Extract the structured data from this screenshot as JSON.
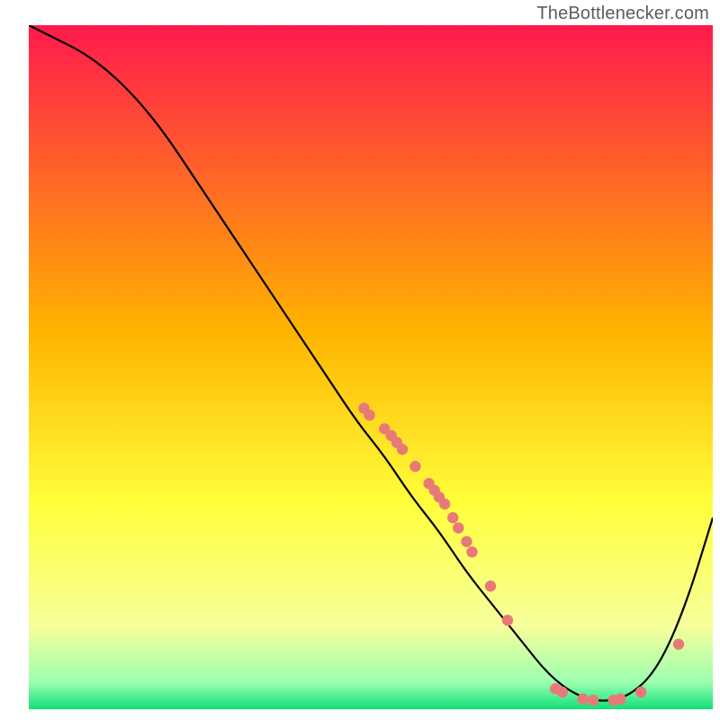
{
  "attribution": "TheBottlenecker.com",
  "colors": {
    "gradient": [
      {
        "offset": "0%",
        "color": "#ff1a4d"
      },
      {
        "offset": "45%",
        "color": "#ffb400"
      },
      {
        "offset": "70%",
        "color": "#ffff3c"
      },
      {
        "offset": "88%",
        "color": "#f6ff9c"
      },
      {
        "offset": "96%",
        "color": "#9cffb0"
      },
      {
        "offset": "100%",
        "color": "#12e07a"
      }
    ],
    "curve_stroke": "#000000",
    "dot_fill": "#e77a78",
    "dot_stroke": "#b65553"
  },
  "chart_data": {
    "type": "line",
    "title": "",
    "xlabel": "",
    "ylabel": "",
    "xlim": [
      0,
      100
    ],
    "ylim": [
      0,
      100
    ],
    "note": "Axes unlabeled in source; values are approximate percentages of plot width/height (0–100). y is 'distance from bottom' so low y ≈ green optimum.",
    "series": [
      {
        "name": "curve",
        "x": [
          0,
          4,
          8,
          12,
          16,
          20,
          24,
          28,
          32,
          36,
          40,
          44,
          48,
          52,
          56,
          60,
          64,
          68,
          72,
          76,
          80,
          84,
          88,
          92,
          96,
          100
        ],
        "y": [
          100,
          98,
          96,
          93,
          89,
          84,
          78,
          72,
          66,
          60,
          54,
          48,
          42,
          37,
          31,
          26,
          20,
          15,
          10,
          5,
          2,
          1,
          2,
          6,
          15,
          28
        ]
      }
    ],
    "points": {
      "name": "highlighted-dots",
      "note": "Pink/coral dots sitting on the curve; coordinates approximate.",
      "xy": [
        [
          49.0,
          44.0
        ],
        [
          49.8,
          43.0
        ],
        [
          52.0,
          41.0
        ],
        [
          53.0,
          40.0
        ],
        [
          53.8,
          39.0
        ],
        [
          54.6,
          38.0
        ],
        [
          56.5,
          35.5
        ],
        [
          58.5,
          33.0
        ],
        [
          59.3,
          32.0
        ],
        [
          60.0,
          31.0
        ],
        [
          60.8,
          30.0
        ],
        [
          62.0,
          28.0
        ],
        [
          62.8,
          26.5
        ],
        [
          64.0,
          24.5
        ],
        [
          64.8,
          23.0
        ],
        [
          67.5,
          18.0
        ],
        [
          70.0,
          13.0
        ],
        [
          77.0,
          3.0
        ],
        [
          78.0,
          2.5
        ],
        [
          81.0,
          1.5
        ],
        [
          82.5,
          1.3
        ],
        [
          85.5,
          1.3
        ],
        [
          86.5,
          1.5
        ],
        [
          89.5,
          2.5
        ],
        [
          95.0,
          9.5
        ]
      ]
    }
  }
}
